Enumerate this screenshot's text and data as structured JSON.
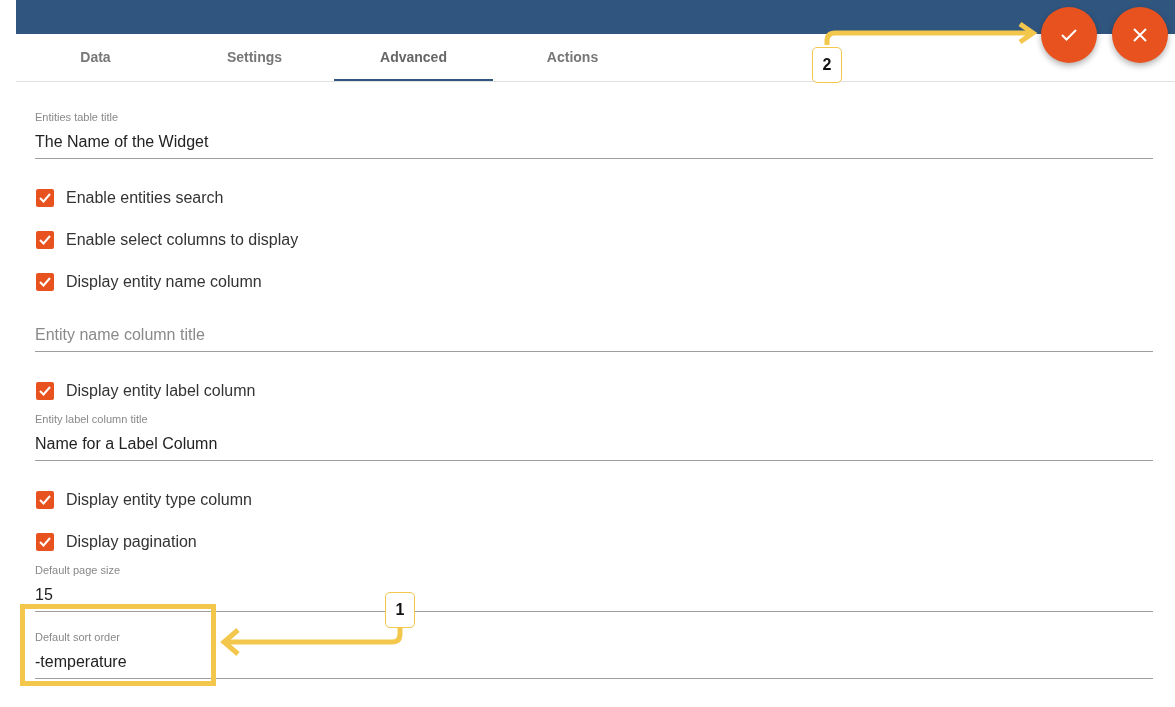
{
  "tabs": [
    {
      "label": "Data",
      "selected": false
    },
    {
      "label": "Settings",
      "selected": false
    },
    {
      "label": "Advanced",
      "selected": true
    },
    {
      "label": "Actions",
      "selected": false
    }
  ],
  "actions": [
    {
      "kind": "apply"
    },
    {
      "kind": "close"
    }
  ],
  "form": [
    {
      "kind": "field",
      "label": "Entities table title",
      "value": "The Name of the Widget"
    },
    {
      "kind": "checkbox",
      "label": "Enable entities search",
      "checked": true
    },
    {
      "kind": "checkbox",
      "label": "Enable select columns to display",
      "checked": true
    },
    {
      "kind": "checkbox",
      "label": "Display entity name column",
      "checked": true
    },
    {
      "kind": "field",
      "placeholder": "Entity name column title"
    },
    {
      "kind": "checkbox",
      "label": "Display entity label column",
      "checked": true
    },
    {
      "kind": "field",
      "label": "Entity label column title",
      "value": "Name for a Label Column"
    },
    {
      "kind": "checkbox",
      "label": "Display entity type column",
      "checked": true
    },
    {
      "kind": "checkbox",
      "label": "Display pagination",
      "checked": true
    },
    {
      "kind": "field",
      "label": "Default page size",
      "value": "15"
    },
    {
      "kind": "field",
      "label": "Default sort order",
      "value": "-temperature"
    }
  ],
  "annotations": [
    {
      "number": "1"
    },
    {
      "number": "2"
    }
  ]
}
